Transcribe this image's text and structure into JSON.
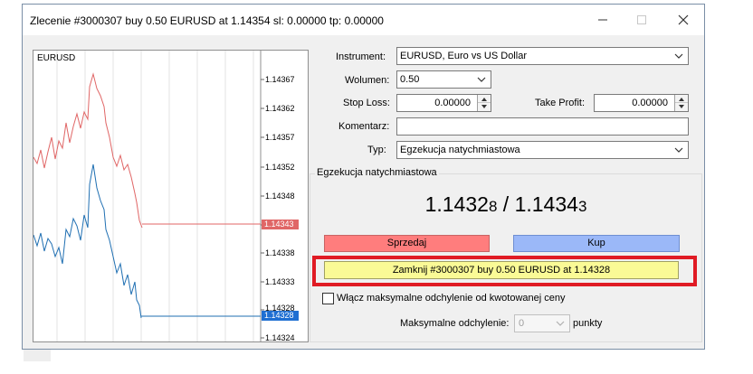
{
  "window": {
    "title": "Zlecenie #3000307 buy 0.50 EURUSD at 1.14354 sl: 0.00000 tp: 0.00000",
    "controls": [
      "minimize-icon",
      "maximize-icon",
      "close-icon"
    ]
  },
  "chart": {
    "symbol": "EURUSD",
    "price_labels": [
      "1.14367",
      "1.14362",
      "1.14357",
      "1.14352",
      "1.14348",
      "1.14338",
      "1.14333",
      "1.14328",
      "1.14324"
    ],
    "ask_marker": "1.14343",
    "bid_marker": "1.14328",
    "colors": {
      "ask": "#e06666",
      "bid": "#1f6fb2",
      "ask_marker_bg": "#e06666",
      "bid_marker_bg": "#1f6fd2"
    }
  },
  "form": {
    "instrument_label": "Instrument:",
    "instrument_value": "EURUSD, Euro vs US Dollar",
    "volume_label": "Wolumen:",
    "volume_value": "0.50",
    "stoploss_label": "Stop Loss:",
    "stoploss_value": "0.00000",
    "takeprofit_label": "Take Profit:",
    "takeprofit_value": "0.00000",
    "comment_label": "Komentarz:",
    "comment_value": "",
    "type_label": "Typ:",
    "type_value": "Egzekucja natychmiastowa"
  },
  "execution": {
    "group_title": "Egzekucja natychmiastowa",
    "bid_main": "1.1432",
    "bid_small": "8",
    "separator": " / ",
    "ask_main": "1.1434",
    "ask_small": "3",
    "sell_label": "Sprzedaj",
    "buy_label": "Kup",
    "close_label": "Zamknij #3000307 buy 0.50 EURUSD at 1.14328",
    "max_dev_checkbox_label": "Włącz maksymalne odchylenie od kwotowanej ceny",
    "max_dev_label": "Maksymalne odchylenie:",
    "max_dev_value": "0",
    "max_dev_unit": "punkty"
  }
}
